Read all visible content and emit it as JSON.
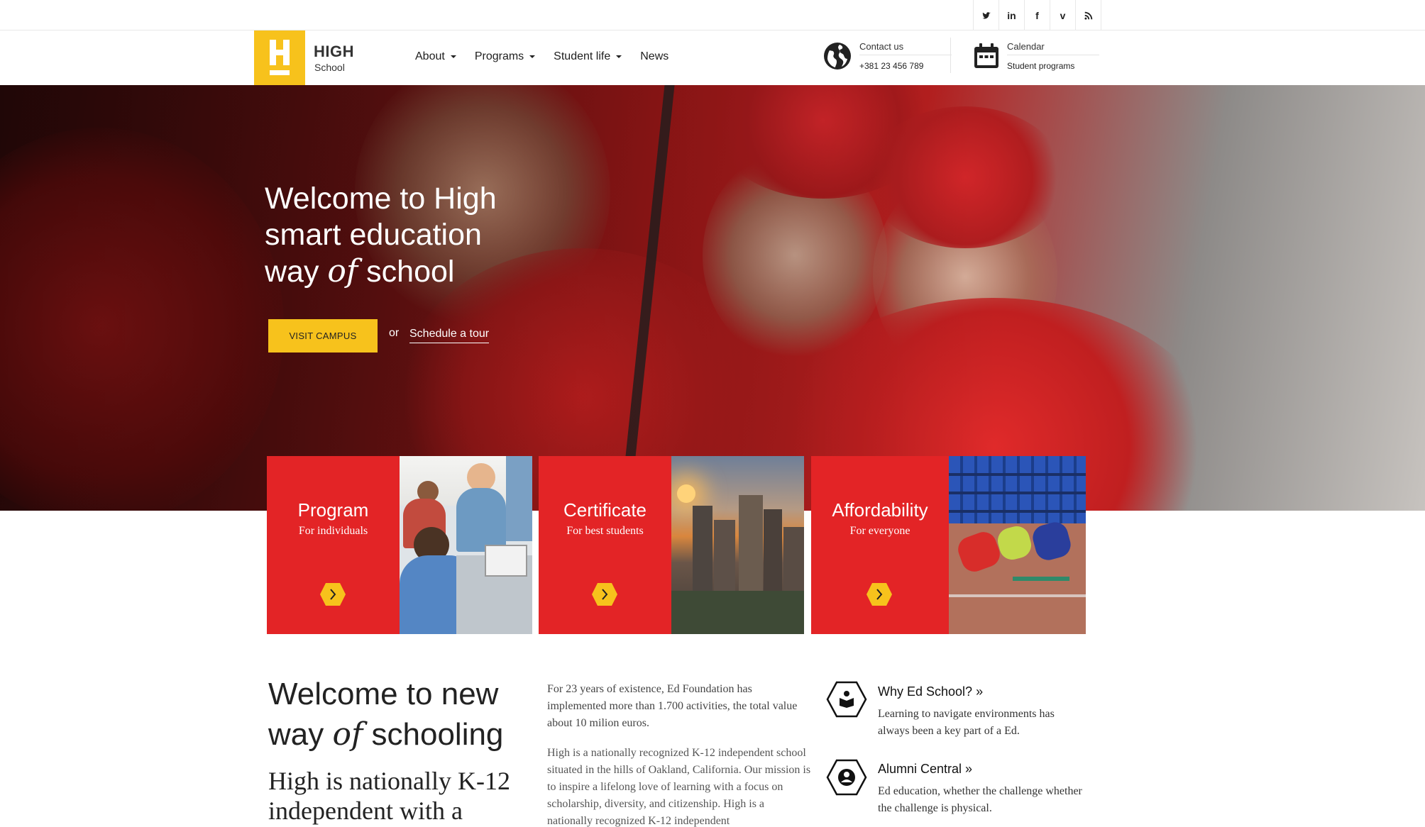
{
  "social": {
    "icons": [
      "twitter-icon",
      "linkedin-icon",
      "facebook-icon",
      "vimeo-icon",
      "rss-icon"
    ],
    "labels": {
      "linkedin": "in",
      "facebook": "f",
      "vimeo": "v"
    }
  },
  "brand": {
    "name": "HIGH",
    "tagline": "School",
    "accent": "#f7c21c"
  },
  "nav": {
    "items": [
      {
        "label": "About",
        "dropdown": true
      },
      {
        "label": "Programs",
        "dropdown": true
      },
      {
        "label": "Student life",
        "dropdown": true
      },
      {
        "label": "News",
        "dropdown": false
      }
    ]
  },
  "header_contacts": {
    "contact": {
      "label": "Contact us",
      "value": "+381 23 456 789",
      "icon": "globe-icon"
    },
    "calendar": {
      "label": "Calendar",
      "value": "Student programs",
      "icon": "calendar-icon"
    }
  },
  "hero": {
    "title_line1": "Welcome to High",
    "title_line2": "smart education",
    "title_line3_a": "way",
    "title_line3_of": "of",
    "title_line3_b": "school",
    "cta_button": "Visit campus",
    "or_text": "or",
    "link": "Schedule a tour"
  },
  "cards": [
    {
      "title": "Program",
      "subtitle": "For individuals",
      "color": "#e32426"
    },
    {
      "title": "Certificate",
      "subtitle": "For best students",
      "color": "#e32426"
    },
    {
      "title": "Affordability",
      "subtitle": "For everyone",
      "color": "#e32426"
    }
  ],
  "intro": {
    "heading_a": "Welcome to new",
    "heading_b1": "way",
    "heading_of": "of",
    "heading_b2": "schooling",
    "subheading": "High is nationally K-12 independent with a",
    "lead": "For 23 years of existence, Ed Foundation has implemented more than 1.700 activities, the total value about 10 milion euros.",
    "body": "High is a nationally recognized K-12 independent school situated in the hills of Oakland, California. Our mission is to inspire a lifelong love of learning with a focus on scholarship, diversity, and citizenship. High is a nationally recognized K-12 independent"
  },
  "features": [
    {
      "title": "Why Ed School? »",
      "text": "Learning to navigate environments has always been a key part of a Ed.",
      "icon": "book-reader-icon"
    },
    {
      "title": "Alumni Central »",
      "text": "Ed education, whether the challenge whether the challenge is physical.",
      "icon": "user-circle-icon"
    }
  ]
}
